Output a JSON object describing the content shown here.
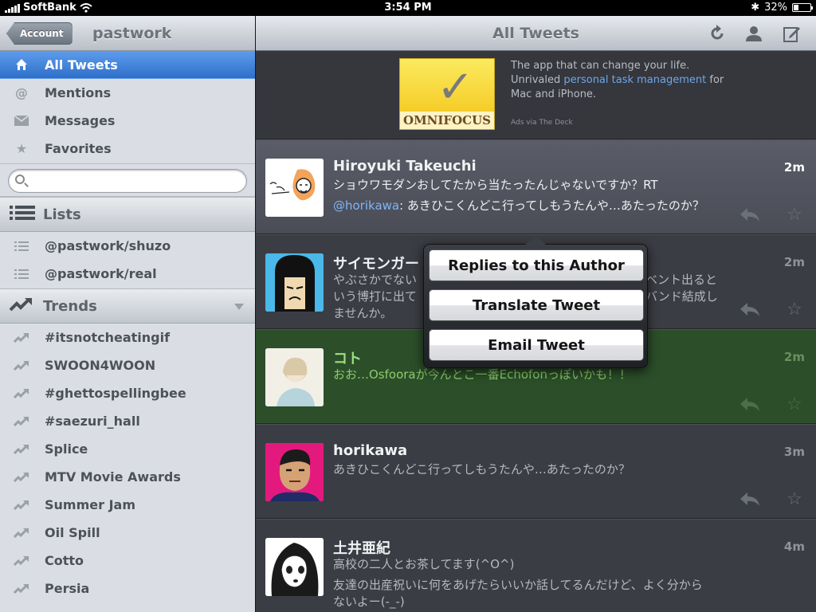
{
  "status_bar": {
    "carrier": "SoftBank",
    "time": "3:54 PM",
    "battery": "32%",
    "battery_level": 0.32
  },
  "sidebar": {
    "back_button": "Account",
    "title": "pastwork",
    "nav": [
      {
        "label": "All Tweets",
        "icon": "home-icon",
        "selected": true
      },
      {
        "label": "Mentions",
        "icon": "at-icon",
        "selected": false
      },
      {
        "label": "Messages",
        "icon": "envelope-icon",
        "selected": false
      },
      {
        "label": "Favorites",
        "icon": "star-icon",
        "selected": false
      }
    ],
    "search": {
      "placeholder": "",
      "value": ""
    },
    "lists": {
      "header": "Lists",
      "items": [
        "@pastwork/shuzo",
        "@pastwork/real"
      ]
    },
    "trends": {
      "header": "Trends",
      "items": [
        "#itsnotcheatingif",
        "SWOON4WOON",
        "#ghettospellingbee",
        "#saezuri_hall",
        "Splice",
        "MTV Movie Awards",
        "Summer Jam",
        "Oil Spill",
        "Cotto",
        "Persia"
      ]
    }
  },
  "main": {
    "title": "All Tweets",
    "toolbar": {
      "refresh_icon": "refresh-icon",
      "profile_icon": "person-icon",
      "compose_icon": "compose-icon"
    },
    "ad": {
      "brand": "OMNIFOCUS",
      "line1": "The app that can change your life.",
      "line2_pre": "Unrivaled ",
      "line2_link": "personal task management",
      "line2_post": " for",
      "line3": "Mac and iPhone.",
      "via": "Ads via The Deck"
    },
    "tweets": [
      {
        "name": "Hiroyuki Takeuchi",
        "time": "2m",
        "line1": "ショウワモダンおしてたから当たったんじゃないですか？RT",
        "mention": "@horikawa",
        "line2": ": あきひこくんどこ行ってしもうたんや…あたったのか？"
      },
      {
        "name": "サイモンガー",
        "time": "2m",
        "line1": "やぶさかでない",
        "line1b": "ベント出ると",
        "line2": "いう博打に出て",
        "line2b": "バンド結成し",
        "line3": "ませんか。"
      },
      {
        "name": "コト",
        "time": "2m",
        "line1": "おお…Osfooraが今んとこ一番Echofonっぽいかも！！"
      },
      {
        "name": "horikawa",
        "time": "3m",
        "line1": "あきひこくんどこ行ってしもうたんや…あたったのか？"
      },
      {
        "name": "土井亜紀",
        "time": "4m",
        "line1": "高校の二人とお茶してます(^O^)",
        "line2": "友達の出産祝いに何をあげたらいいか話してるんだけど、よく分から",
        "line3": "ないよー(-_-)"
      }
    ]
  },
  "popover": {
    "buttons": [
      "Replies to this Author",
      "Translate Tweet",
      "Email Tweet"
    ]
  }
}
